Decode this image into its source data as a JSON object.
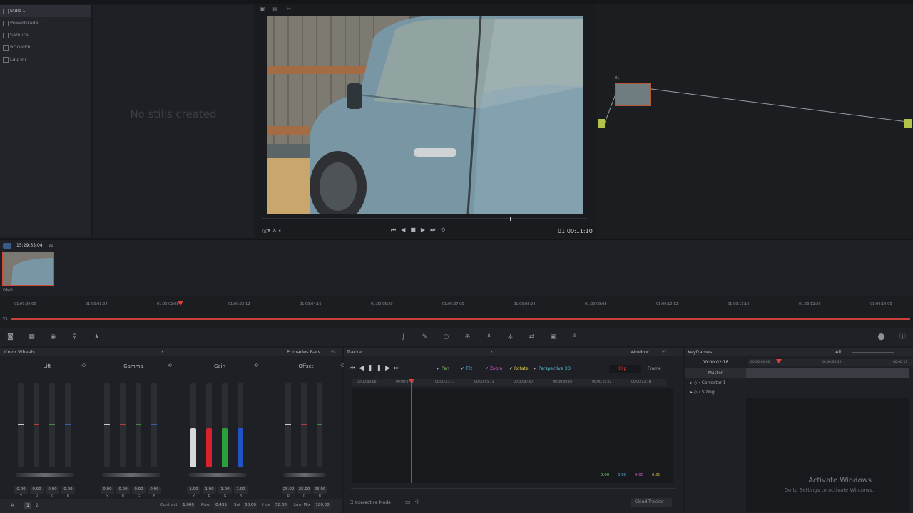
{
  "gallery": {
    "albums": [
      "Stills 1",
      "PowerGrade 1",
      "Samurai",
      "BOOMER",
      "Lauren"
    ],
    "empty_message": "No stills created"
  },
  "viewer": {
    "timecode": "01:00:11:10"
  },
  "clips": {
    "timecode": "15:29:53:04",
    "track": "V1",
    "clip_number": "01",
    "clip_label": "DNG"
  },
  "timeline": {
    "ruler": [
      "01:00:00:00",
      "01:00:01:04",
      "01:00:02:08",
      "01:00:03:12",
      "01:00:04:16",
      "01:00:05:20",
      "01:00:07:00",
      "01:00:08:04",
      "01:00:09:08",
      "01:00:10:12",
      "01:00:11:16",
      "01:00:12:20",
      "01:00:14:00"
    ],
    "track": "V1"
  },
  "wheels": {
    "title": "Color Wheels",
    "mode": "Primaries Bars",
    "groups": [
      {
        "name": "Lift",
        "values": [
          "0.00",
          "0.00",
          "0.00",
          "0.00"
        ]
      },
      {
        "name": "Gamma",
        "values": [
          "0.00",
          "0.00",
          "0.00",
          "0.00"
        ]
      },
      {
        "name": "Gain",
        "values": [
          "1.00",
          "1.00",
          "1.00",
          "1.00"
        ]
      },
      {
        "name": "Offset",
        "values": [
          "25.00",
          "25.00",
          "25.00"
        ]
      }
    ],
    "channels": [
      "Y",
      "R",
      "G",
      "B"
    ],
    "footer": {
      "contrast_label": "Contrast",
      "contrast": "1.000",
      "pivot_label": "Pivot",
      "pivot": "0.435",
      "sat_label": "Sat",
      "sat": "50.00",
      "hue_label": "Hue",
      "hue": "50.00",
      "lummix_label": "Lum Mix",
      "lummix": "100.00",
      "page1": "1",
      "page2": "2"
    }
  },
  "tracker": {
    "title": "Tracker",
    "mode": "Window",
    "checks": [
      "Pan",
      "Tilt",
      "Zoom",
      "Rotate",
      "Perspective 3D"
    ],
    "clip_btn": "Clip",
    "frame_btn": "Frame",
    "ruler": [
      "00:00:00:00",
      "00:00:07:0",
      "00:00:03:13",
      "00:00:05:11",
      "00:00:07:07",
      "00:00:09:02",
      "00:00:10:22",
      "00:00:12:18"
    ],
    "readouts": [
      "0.00",
      "0.00",
      "0.00",
      "0.00"
    ],
    "interactive_mode": "Interactive Mode",
    "cloud_tracker": "Cloud Tracker"
  },
  "keyframes": {
    "title": "Keyframes",
    "filter": "All",
    "timecode": "00:00:02:18",
    "ruler": [
      "00:00:00:00",
      "00:00:06:12",
      "00:00:13"
    ],
    "rows": [
      "Master",
      "Corrector 1",
      "Sizing"
    ]
  },
  "watermark": {
    "line1": "Activate Windows",
    "line2": "Go to Settings to activate Windows."
  },
  "colors": {
    "playhead": "#e0413b",
    "accent": "#d6e35a"
  }
}
